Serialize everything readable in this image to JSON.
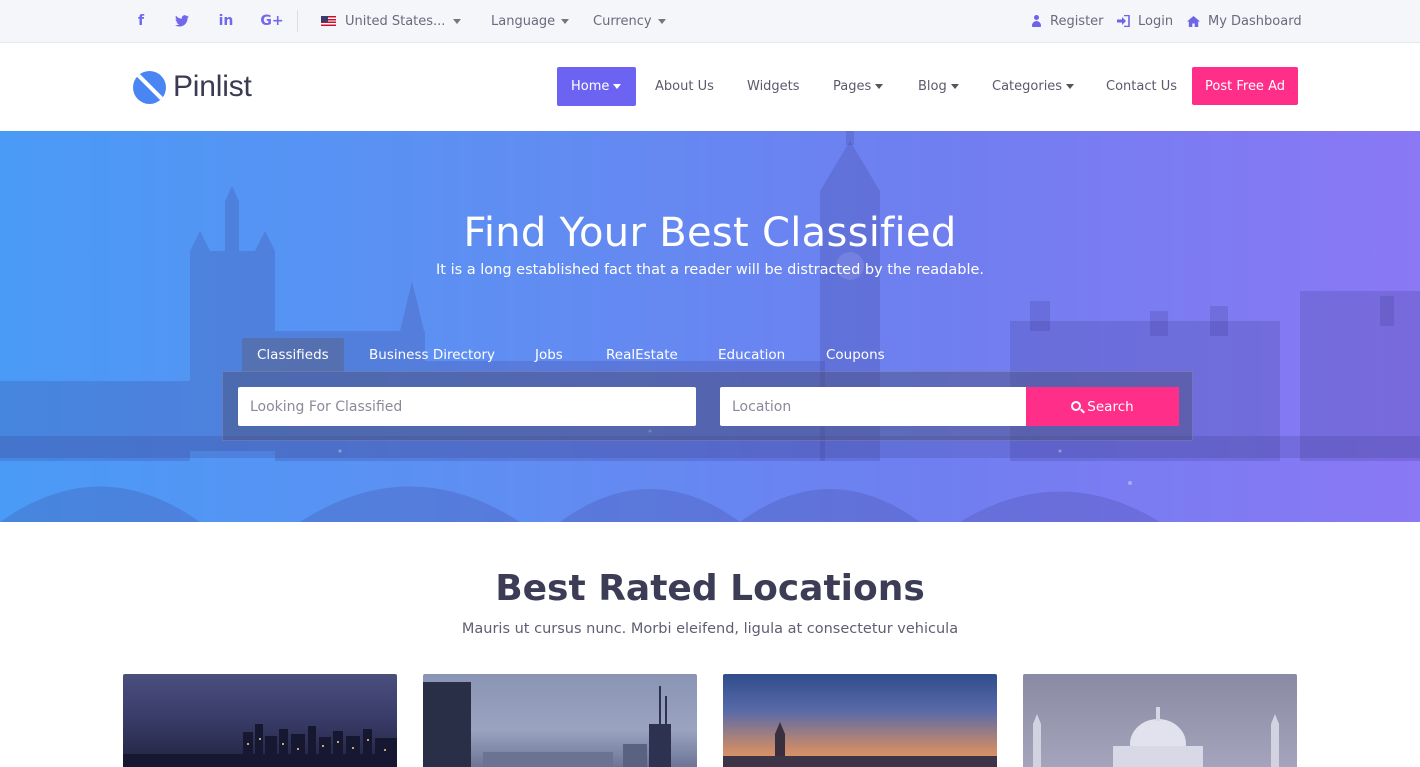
{
  "topbar": {
    "social": [
      {
        "icon": "facebook-icon",
        "glyph": "f"
      },
      {
        "icon": "twitter-icon",
        "glyph": "🐦"
      },
      {
        "icon": "linkedin-icon",
        "glyph": "in"
      },
      {
        "icon": "google-plus-icon",
        "glyph": "G+"
      }
    ],
    "country": "United States...",
    "language": "Language",
    "currency": "Currency",
    "register": "Register",
    "login": "Login",
    "dashboard": "My Dashboard"
  },
  "header": {
    "logo_text": "Pinlist",
    "nav": {
      "home": "Home",
      "about": "About Us",
      "widgets": "Widgets",
      "pages": "Pages",
      "blog": "Blog",
      "categories": "Categories",
      "contact": "Contact Us"
    },
    "post_ad": "Post Free Ad"
  },
  "hero": {
    "title": "Find Your Best Classified",
    "subtitle": "It is a long established fact that a reader will be distracted by the readable.",
    "tabs": {
      "classifieds": "Classifieds",
      "business": "Business Directory",
      "jobs": "Jobs",
      "realestate": "RealEstate",
      "education": "Education",
      "coupons": "Coupons"
    },
    "search": {
      "keyword_placeholder": "Looking For Classified",
      "location_placeholder": "Location",
      "button": "Search"
    }
  },
  "locations": {
    "title": "Best Rated Locations",
    "subtitle": "Mauris ut cursus nunc. Morbi eleifend, ligula at consectetur vehicula"
  },
  "colors": {
    "primary": "#6c63f2",
    "accent_pink": "#ff2e88",
    "hero_gradient_start": "#4a9bf6",
    "hero_gradient_end": "#8a78f4"
  }
}
